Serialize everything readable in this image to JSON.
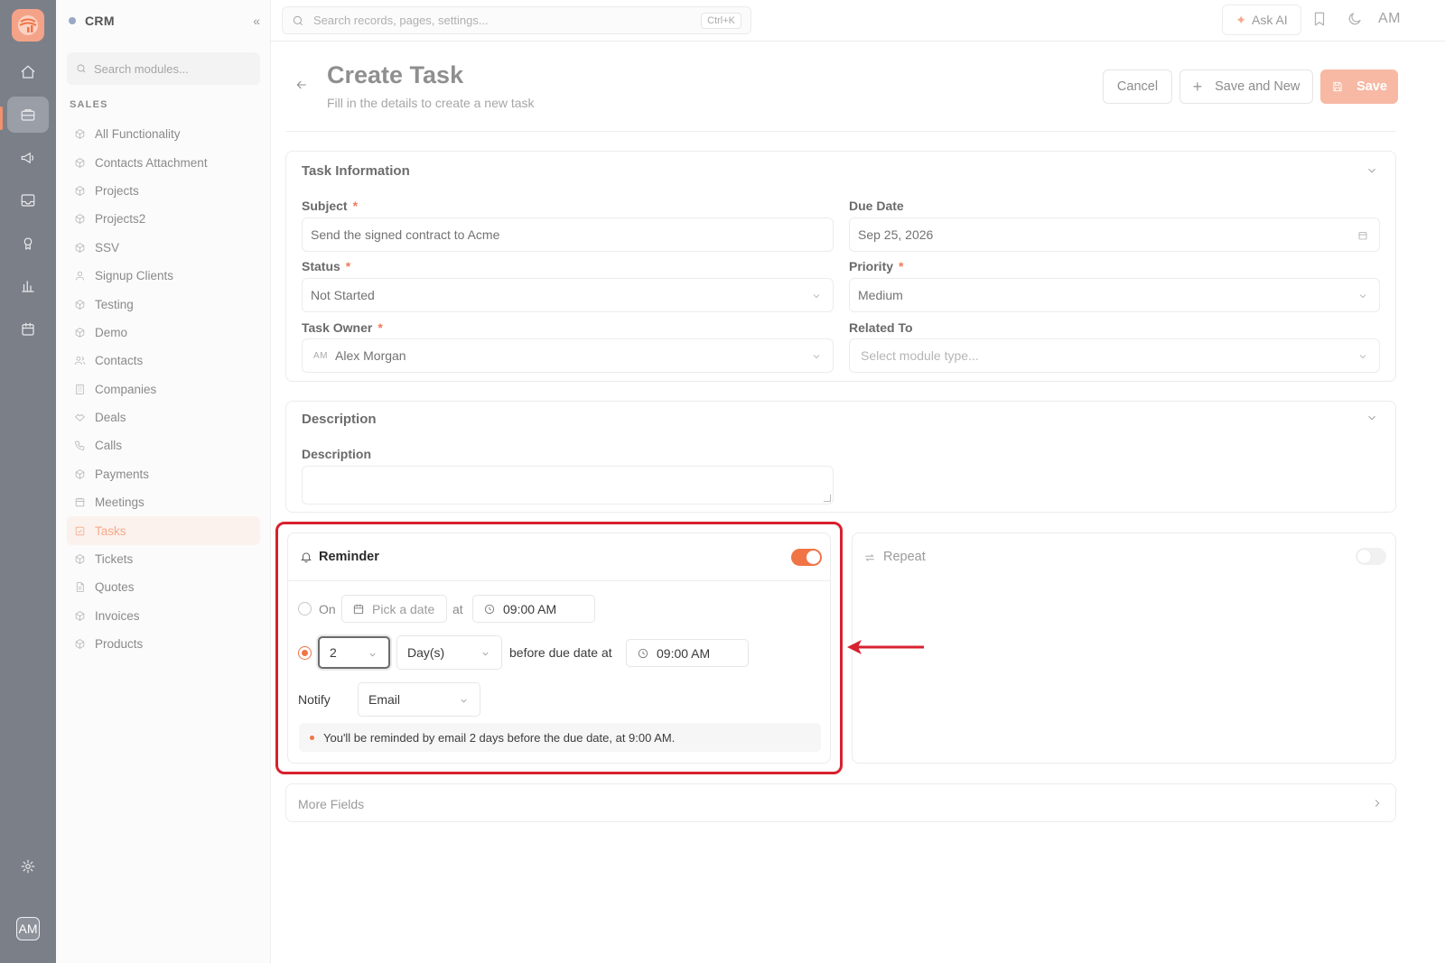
{
  "app": {
    "name": "CRM",
    "user_initials": "AM"
  },
  "rail": {
    "items": [
      "home-icon",
      "briefcase-icon",
      "megaphone-icon",
      "inbox-icon",
      "support-icon",
      "chart-icon",
      "calendar-icon"
    ],
    "active": "briefcase-icon",
    "bottom": [
      "settings-icon"
    ]
  },
  "sidebar": {
    "title": "CRM",
    "search_placeholder": "Search modules...",
    "section": "SALES",
    "items": [
      {
        "label": "All Functionality",
        "icon": "cube-icon"
      },
      {
        "label": "Contacts Attachment",
        "icon": "cube-icon"
      },
      {
        "label": "Projects",
        "icon": "cube-icon"
      },
      {
        "label": "Projects2",
        "icon": "cube-icon"
      },
      {
        "label": "SSV",
        "icon": "cube-icon"
      },
      {
        "label": "Signup Clients",
        "icon": "user-icon"
      },
      {
        "label": "Testing",
        "icon": "cube-icon"
      },
      {
        "label": "Demo",
        "icon": "cube-icon"
      },
      {
        "label": "Contacts",
        "icon": "users-icon"
      },
      {
        "label": "Companies",
        "icon": "building-icon"
      },
      {
        "label": "Deals",
        "icon": "handshake-icon"
      },
      {
        "label": "Calls",
        "icon": "phone-icon"
      },
      {
        "label": "Payments",
        "icon": "cube-icon"
      },
      {
        "label": "Meetings",
        "icon": "calendar-icon"
      },
      {
        "label": "Tasks",
        "icon": "checkbox-icon",
        "active": true
      },
      {
        "label": "Tickets",
        "icon": "cube-icon"
      },
      {
        "label": "Quotes",
        "icon": "file-icon"
      },
      {
        "label": "Invoices",
        "icon": "cube-icon"
      },
      {
        "label": "Products",
        "icon": "cube-icon"
      }
    ]
  },
  "topbar": {
    "search_placeholder": "Search records, pages, settings...",
    "shortcut": "Ctrl+K",
    "ask_ai": "Ask AI",
    "user_initials": "AM"
  },
  "header": {
    "title": "Create Task",
    "subtitle": "Fill in the details to create a new task",
    "cancel": "Cancel",
    "save_and_new": "Save and New",
    "save": "Save"
  },
  "task_info": {
    "title": "Task Information",
    "subject_label": "Subject",
    "subject_value": "Send the signed contract to Acme",
    "due_date_label": "Due Date",
    "due_date_value": "Sep 25, 2026",
    "status_label": "Status",
    "status_value": "Not Started",
    "priority_label": "Priority",
    "priority_value": "Medium",
    "owner_label": "Task Owner",
    "owner_initials": "AM",
    "owner_value": "Alex Morgan",
    "related_label": "Related To",
    "related_placeholder": "Select module type..."
  },
  "description": {
    "title": "Description",
    "label": "Description"
  },
  "reminder": {
    "title": "Reminder",
    "enabled": true,
    "on_label": "On",
    "pick_date": "Pick a date",
    "at_label": "at",
    "on_time": "09:00 AM",
    "count_value": "2",
    "unit_value": "Day(s)",
    "before_label": "before due date at",
    "before_time": "09:00 AM",
    "selected_option": "before",
    "notify_label": "Notify",
    "notify_value": "Email",
    "summary": "You'll be reminded by email 2 days before the due date, at 9:00 AM."
  },
  "repeat": {
    "title": "Repeat",
    "enabled": false
  },
  "more_fields": {
    "title": "More Fields"
  },
  "colors": {
    "accent": "#f07446",
    "highlight": "#d7212f",
    "rail": "#7b7f88"
  }
}
